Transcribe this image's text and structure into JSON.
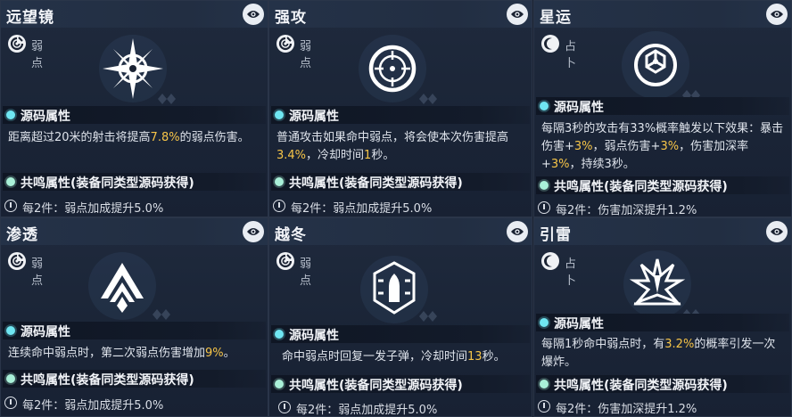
{
  "labels": {
    "source_attr": "源码属性",
    "resonance_attr": "共鸣属性(装备同类型源码获得)"
  },
  "cards": [
    {
      "title": "远望镜",
      "type": "弱点",
      "type_icon": "weakpoint-icon",
      "emblem": "compass-star-icon",
      "desc": [
        {
          "t": "距离超过20米的射击将提高"
        },
        {
          "t": "7.8%",
          "hl": true
        },
        {
          "t": "的弱点伤害。"
        }
      ],
      "bonus": "每2件：弱点加成提升5.0%"
    },
    {
      "title": "强攻",
      "type": "弱点",
      "type_icon": "weakpoint-icon",
      "emblem": "crosshair-icon",
      "desc": [
        {
          "t": "普通攻击如果命中弱点，将会使本次伤害提高"
        },
        {
          "t": "3.4%",
          "hl": true
        },
        {
          "t": "，冷却时间"
        },
        {
          "t": "1",
          "hl": true
        },
        {
          "t": "秒。"
        }
      ],
      "bonus": "每2件：弱点加成提升5.0%"
    },
    {
      "title": "星运",
      "type": "占卜",
      "type_icon": "divination-icon",
      "emblem": "triquetra-icon",
      "desc": [
        {
          "t": "每隔3秒的攻击有33%概率触发以下效果：暴击伤害+"
        },
        {
          "t": "3%",
          "hl": true
        },
        {
          "t": "，弱点伤害+"
        },
        {
          "t": "3%",
          "hl": true
        },
        {
          "t": "，伤害加深率+"
        },
        {
          "t": "3%",
          "hl": true
        },
        {
          "t": "，持续3秒。"
        }
      ],
      "bonus": "每2件：伤害加深提升1.2%"
    },
    {
      "title": "渗透",
      "type": "弱点",
      "type_icon": "weakpoint-icon",
      "emblem": "chevron-arrow-icon",
      "desc": [
        {
          "t": "连续命中弱点时，第二次弱点伤害增加"
        },
        {
          "t": "9%",
          "hl": true
        },
        {
          "t": "。"
        }
      ],
      "bonus": "每2件：弱点加成提升5.0%"
    },
    {
      "title": "越冬",
      "type": "弱点",
      "type_icon": "weakpoint-icon",
      "emblem": "bullet-shield-icon",
      "desc": [
        {
          "t": "命中弱点时回复一发子弹，冷却时间"
        },
        {
          "t": "13",
          "hl": true
        },
        {
          "t": "秒。"
        }
      ],
      "bonus": "每2件：弱点加成提升5.0%"
    },
    {
      "title": "引雷",
      "type": "占卜",
      "type_icon": "divination-icon",
      "emblem": "lightning-burst-icon",
      "desc": [
        {
          "t": "每隔1秒命中弱点时，有"
        },
        {
          "t": "3.2%",
          "hl": true
        },
        {
          "t": "的概率引发一次爆炸。"
        }
      ],
      "bonus": "每2件：伤害加深提升1.2%"
    }
  ]
}
